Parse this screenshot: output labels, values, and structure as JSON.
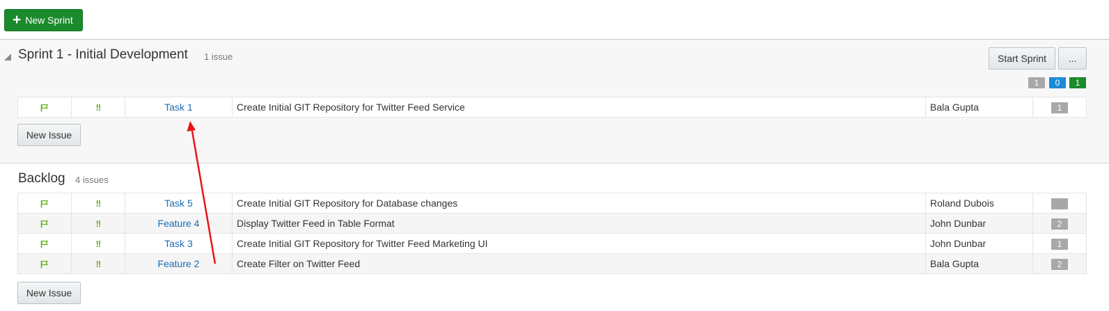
{
  "toolbar": {
    "new_sprint_label": "New Sprint"
  },
  "sprint": {
    "title": "Sprint 1 - Initial Development",
    "count": "1 issue",
    "start_label": "Start Sprint",
    "more_label": "...",
    "badges": [
      {
        "value": "1",
        "color": "#a8a8a8"
      },
      {
        "value": "0",
        "color": "#1a8bd6"
      },
      {
        "value": "1",
        "color": "#1a8a2c"
      }
    ],
    "issues": [
      {
        "key": "Task 1",
        "summary": "Create Initial GIT Repository for Twitter Feed Service",
        "assignee": "Bala Gupta",
        "points": "1",
        "priority_icon": "!!"
      }
    ],
    "new_issue_label": "New Issue"
  },
  "backlog": {
    "title": "Backlog",
    "count": "4 issues",
    "issues": [
      {
        "key": "Task 5",
        "summary": "Create Initial GIT Repository for Database changes",
        "assignee": "Roland Dubois",
        "points": "",
        "priority_icon": "!!"
      },
      {
        "key": "Feature 4",
        "summary": "Display Twitter Feed in Table Format",
        "assignee": "John Dunbar",
        "points": "2",
        "priority_icon": "!!"
      },
      {
        "key": "Task 3",
        "summary": "Create Initial GIT Repository for Twitter Feed Marketing UI",
        "assignee": "John Dunbar",
        "points": "1",
        "priority_icon": "!!"
      },
      {
        "key": "Feature 2",
        "summary": "Create Filter on Twitter Feed",
        "assignee": "Bala Gupta",
        "points": "2",
        "priority_icon": "!!"
      }
    ],
    "new_issue_label": "New Issue"
  },
  "colors": {
    "accent_green": "#1a8a2c",
    "link": "#1a6bb5",
    "annotation_arrow": "#e8141c",
    "priority": "#6ab023"
  }
}
